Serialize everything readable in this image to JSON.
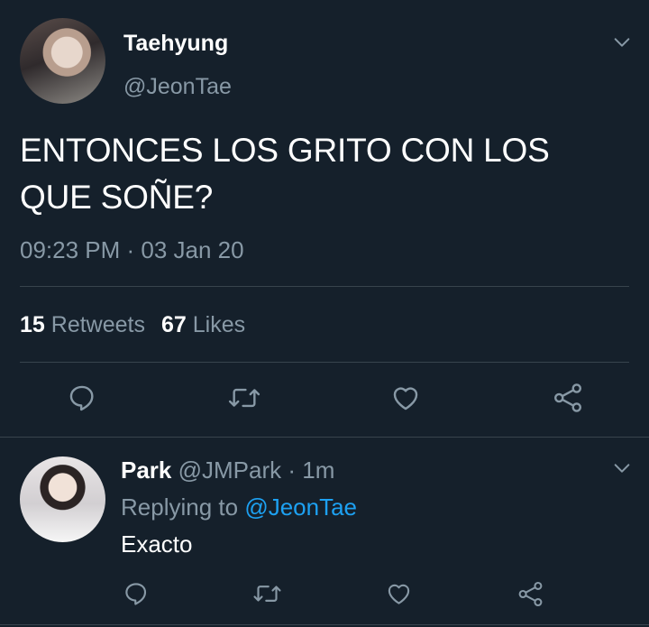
{
  "tweet": {
    "author_name": "Taehyung",
    "author_handle": "@JeonTae",
    "text": "ENTONCES LOS GRITO CON LOS QUE SOÑE?",
    "timestamp": "09:23 PM · 03 Jan 20",
    "retweets_count": "15",
    "retweets_label": "Retweets",
    "likes_count": "67",
    "likes_label": "Likes",
    "actions": [
      "reply-icon",
      "retweet-icon",
      "like-icon",
      "share-icon"
    ]
  },
  "reply": {
    "author_name": "Park",
    "author_handle": "@JMPark",
    "separator": "·",
    "time_ago": "1m",
    "replying_prefix": "Replying to",
    "replying_handle": "@JeonTae",
    "text": "Exacto",
    "actions": [
      "reply-icon",
      "retweet-icon",
      "like-icon",
      "share-icon"
    ]
  },
  "colors": {
    "background": "#15202b",
    "primary_text": "#ffffff",
    "secondary_text": "#8899a6",
    "link": "#1da1f2",
    "divider": "#38444d"
  }
}
